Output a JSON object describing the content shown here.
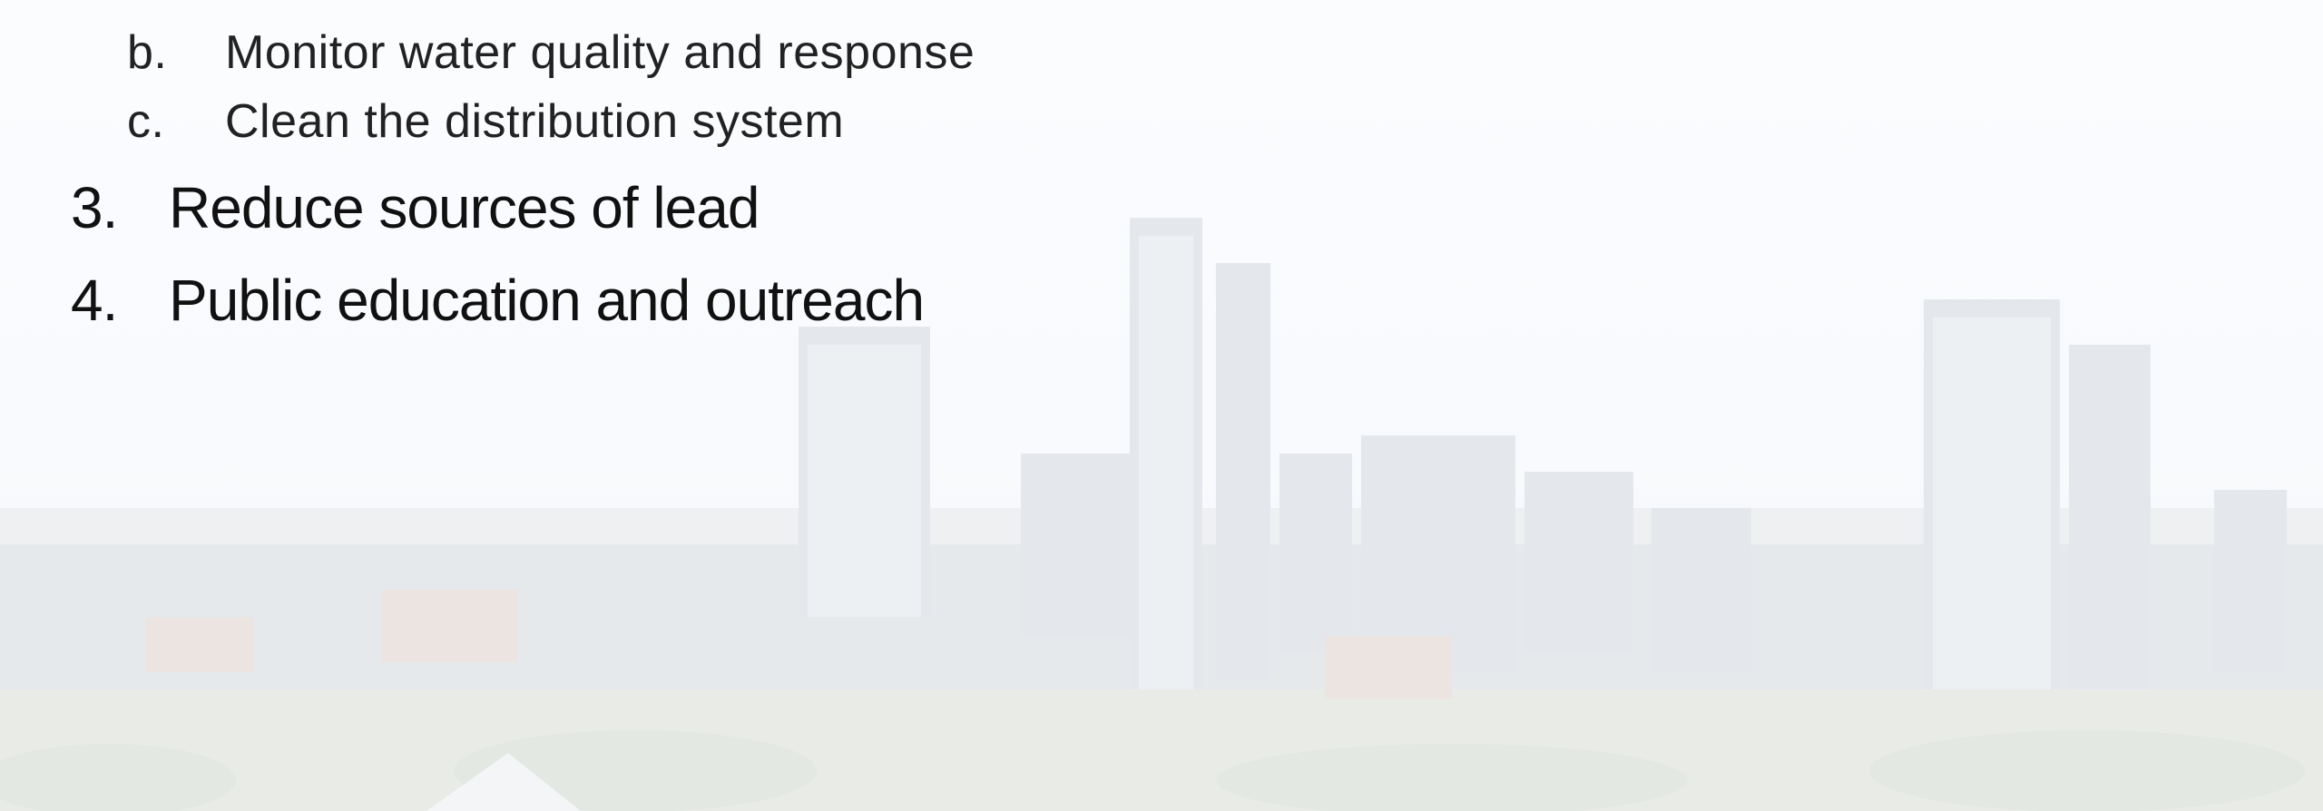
{
  "outline": {
    "sub_items": [
      {
        "marker": "b.",
        "text": "Monitor water quality and response"
      },
      {
        "marker": "c.",
        "text": "Clean the distribution system"
      }
    ],
    "main_items": [
      {
        "marker": "3.",
        "text": "Reduce sources of lead"
      },
      {
        "marker": "4.",
        "text": "Public education and outreach"
      }
    ]
  }
}
